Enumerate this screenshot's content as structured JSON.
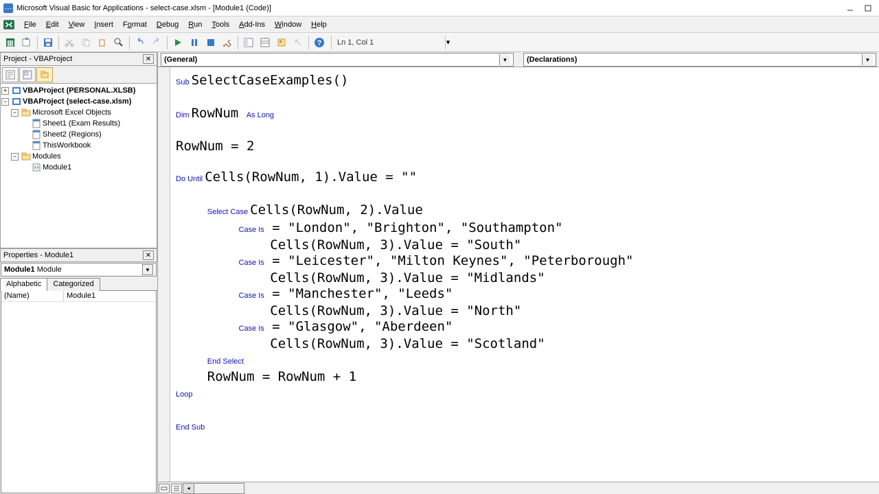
{
  "window": {
    "title": "Microsoft Visual Basic for Applications - select-case.xlsm - [Module1 (Code)]"
  },
  "menu": {
    "items": [
      {
        "label": "File",
        "u": "F"
      },
      {
        "label": "Edit",
        "u": "E"
      },
      {
        "label": "View",
        "u": "V"
      },
      {
        "label": "Insert",
        "u": "I"
      },
      {
        "label": "Format",
        "u": "o"
      },
      {
        "label": "Debug",
        "u": "D"
      },
      {
        "label": "Run",
        "u": "R"
      },
      {
        "label": "Tools",
        "u": "T"
      },
      {
        "label": "Add-Ins",
        "u": "A"
      },
      {
        "label": "Window",
        "u": "W"
      },
      {
        "label": "Help",
        "u": "H"
      }
    ]
  },
  "toolbar": {
    "status": "Ln 1, Col 1"
  },
  "project_pane": {
    "title": "Project - VBAProject",
    "nodes": {
      "p1": "VBAProject (PERSONAL.XLSB)",
      "p2": "VBAProject (select-case.xlsm)",
      "p2a": "Microsoft Excel Objects",
      "p2a1": "Sheet1 (Exam Results)",
      "p2a2": "Sheet2 (Regions)",
      "p2a3": "ThisWorkbook",
      "p2b": "Modules",
      "p2b1": "Module1"
    }
  },
  "props_pane": {
    "title": "Properties - Module1",
    "combo_name": "Module1",
    "combo_type": "Module",
    "tab_a": "Alphabetic",
    "tab_b": "Categorized",
    "row1_k": "(Name)",
    "row1_v": "Module1"
  },
  "editor": {
    "combo_left": "(General)",
    "combo_right": "(Declarations)",
    "code_lines": [
      {
        "t": "kw",
        "s": "Sub "
      },
      {
        "t": "",
        "s": "SelectCaseExamples()"
      },
      {
        "t": "nl"
      },
      {
        "t": "nl"
      },
      {
        "t": "kw",
        "s": "Dim "
      },
      {
        "t": "",
        "s": "RowNum "
      },
      {
        "t": "kw",
        "s": "As Long"
      },
      {
        "t": "nl"
      },
      {
        "t": "nl"
      },
      {
        "t": "",
        "s": "RowNum = 2"
      },
      {
        "t": "nl"
      },
      {
        "t": "nl"
      },
      {
        "t": "kw",
        "s": "Do Until "
      },
      {
        "t": "",
        "s": "Cells(RowNum, 1).Value = \"\""
      },
      {
        "t": "nl"
      },
      {
        "t": "nl"
      },
      {
        "t": "",
        "s": "    "
      },
      {
        "t": "kw",
        "s": "Select Case "
      },
      {
        "t": "",
        "s": "Cells(RowNum, 2).Value"
      },
      {
        "t": "nl"
      },
      {
        "t": "",
        "s": "        "
      },
      {
        "t": "kw",
        "s": "Case Is"
      },
      {
        "t": "",
        "s": " = \"London\", \"Brighton\", \"Southampton\""
      },
      {
        "t": "nl"
      },
      {
        "t": "",
        "s": "            Cells(RowNum, 3).Value = \"South\""
      },
      {
        "t": "nl"
      },
      {
        "t": "",
        "s": "        "
      },
      {
        "t": "kw",
        "s": "Case Is"
      },
      {
        "t": "",
        "s": " = \"Leicester\", \"Milton Keynes\", \"Peterborough\""
      },
      {
        "t": "nl"
      },
      {
        "t": "",
        "s": "            Cells(RowNum, 3).Value = \"Midlands\""
      },
      {
        "t": "nl"
      },
      {
        "t": "",
        "s": "        "
      },
      {
        "t": "kw",
        "s": "Case Is"
      },
      {
        "t": "",
        "s": " = \"Manchester\", \"Leeds\""
      },
      {
        "t": "nl"
      },
      {
        "t": "",
        "s": "            Cells(RowNum, 3).Value = \"North\""
      },
      {
        "t": "nl"
      },
      {
        "t": "",
        "s": "        "
      },
      {
        "t": "kw",
        "s": "Case Is"
      },
      {
        "t": "",
        "s": " = \"Glasgow\", \"Aberdeen\""
      },
      {
        "t": "nl"
      },
      {
        "t": "",
        "s": "            Cells(RowNum, 3).Value = \"Scotland\""
      },
      {
        "t": "nl"
      },
      {
        "t": "",
        "s": "    "
      },
      {
        "t": "kw",
        "s": "End Select"
      },
      {
        "t": "nl"
      },
      {
        "t": "",
        "s": "    RowNum = RowNum + 1"
      },
      {
        "t": "nl"
      },
      {
        "t": "kw",
        "s": "Loop"
      },
      {
        "t": "nl"
      },
      {
        "t": "nl"
      },
      {
        "t": "kw",
        "s": "End Sub"
      },
      {
        "t": "nl"
      }
    ]
  }
}
